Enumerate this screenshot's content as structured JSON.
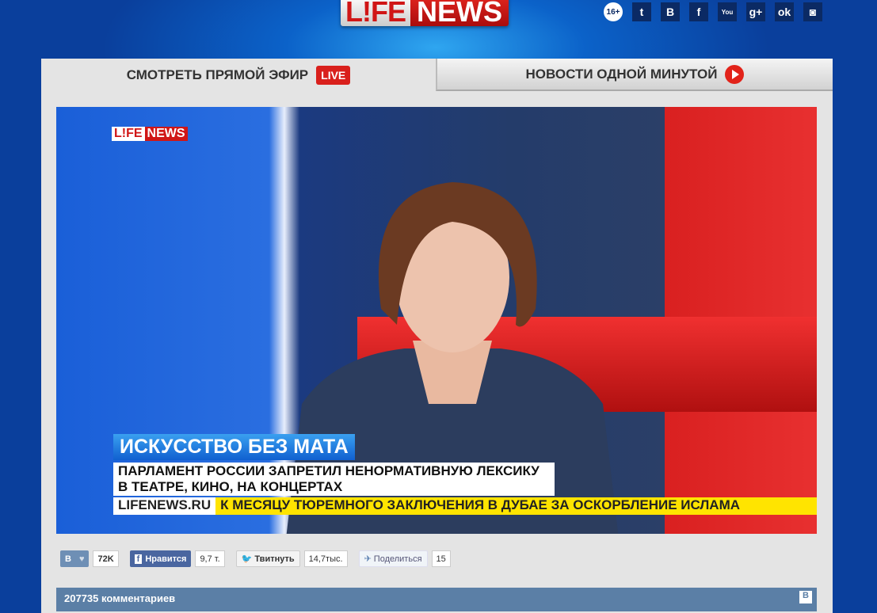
{
  "header": {
    "logo_left": "L!FE",
    "logo_right": "NEWS",
    "age_rating": "16+",
    "social": [
      "twitter",
      "vk",
      "facebook",
      "youtube",
      "google-plus",
      "odnoklassniki",
      "instagram"
    ]
  },
  "tabs": [
    {
      "label": "СМОТРЕТЬ ПРЯМОЙ ЭФИР",
      "badge": "LIVE"
    },
    {
      "label": "НОВОСТИ ОДНОЙ МИНУТОЙ"
    }
  ],
  "video": {
    "logo_left": "L!FE",
    "logo_right": "NEWS",
    "headline": "ИСКУССТВО БЕЗ МАТА",
    "subtitle_line1": "ПАРЛАМЕНТ РОССИИ ЗАПРЕТИЛ НЕНОРМАТИВНУЮ ЛЕКСИКУ",
    "subtitle_line2": "В ТЕАТРЕ, КИНО, НА КОНЦЕРТАХ",
    "ticker_site": "LIFENEWS.RU",
    "ticker_text": "К МЕСЯЦУ ТЮРЕМНОГО ЗАКЛЮЧЕНИЯ В ДУБАЕ ЗА ОСКОРБЛЕНИЕ ИСЛАМА"
  },
  "share": {
    "vk_label": "В",
    "vk_count": "72K",
    "fb_label": "Нравится",
    "fb_count": "9,7 т.",
    "tw_label": "Твитнуть",
    "tw_count": "14,7тыс.",
    "mr_label": "Поделиться",
    "mr_count": "15"
  },
  "comments": {
    "title": "207735 комментариев",
    "vk": "В"
  }
}
